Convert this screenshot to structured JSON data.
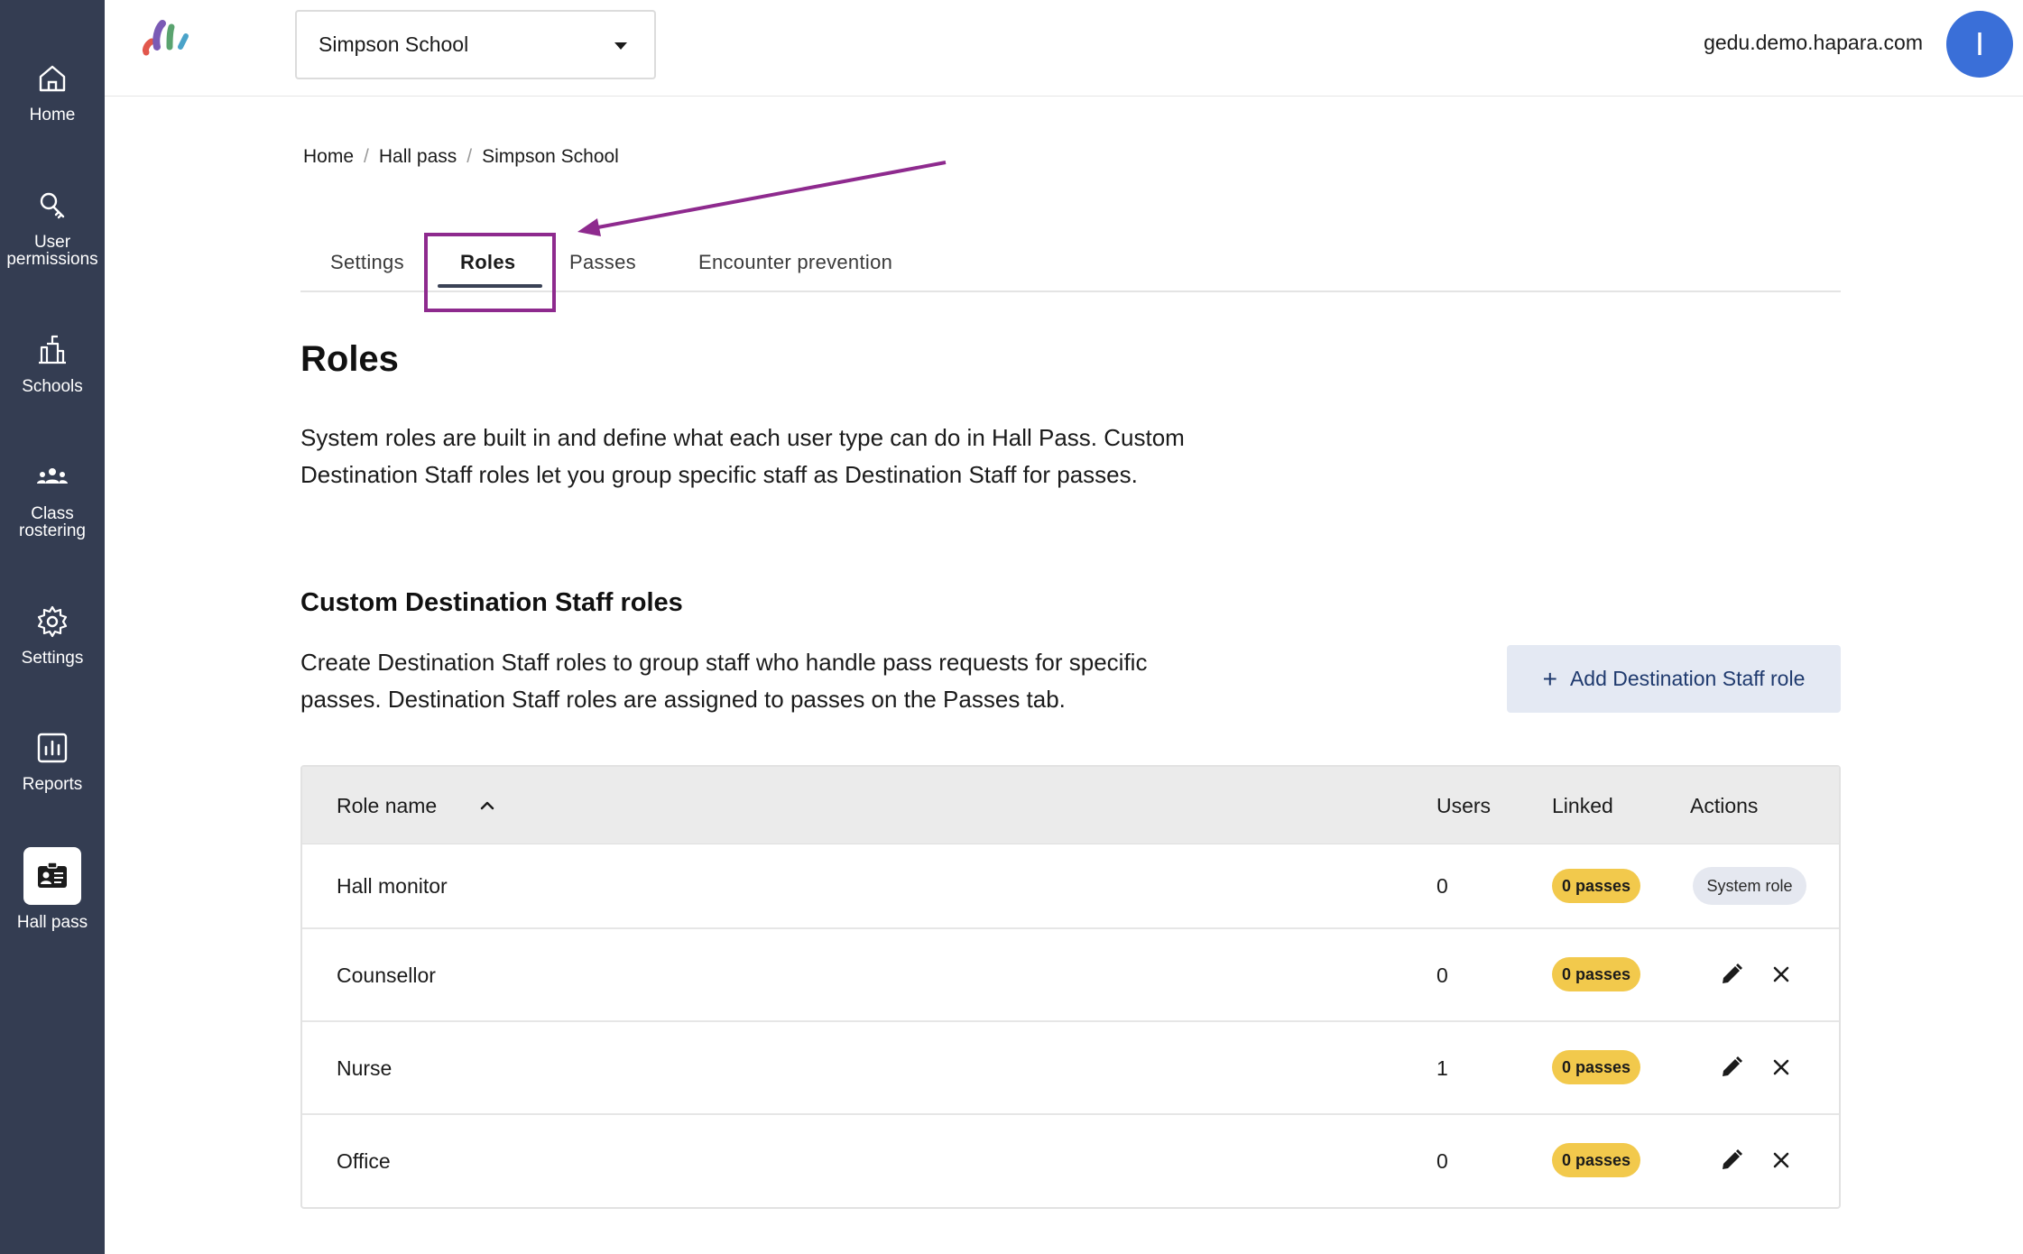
{
  "sidebar": {
    "items": [
      {
        "label": "Home",
        "icon": "home-icon"
      },
      {
        "label": "User permissions",
        "icon": "key-icon"
      },
      {
        "label": "Schools",
        "icon": "school-building-icon"
      },
      {
        "label": "Class rostering",
        "icon": "people-group-icon"
      },
      {
        "label": "Settings",
        "icon": "gear-icon"
      },
      {
        "label": "Reports",
        "icon": "bar-chart-icon"
      },
      {
        "label": "Hall pass",
        "icon": "id-card-icon",
        "active": true
      }
    ]
  },
  "header": {
    "school_select": "Simpson School",
    "domain": "gedu.demo.hapara.com",
    "avatar_initial": "I"
  },
  "breadcrumb": [
    "Home",
    "Hall pass",
    "Simpson School"
  ],
  "tabs": [
    {
      "label": "Settings"
    },
    {
      "label": "Roles",
      "active": true
    },
    {
      "label": "Passes"
    },
    {
      "label": "Encounter prevention"
    }
  ],
  "page": {
    "title": "Roles",
    "description": "System roles are built in and define what each user type can do in Hall Pass. Custom Destination Staff roles let you group specific staff as Destination Staff for passes.",
    "section_title": "Custom Destination Staff roles",
    "section_description": "Create Destination Staff roles to group staff who handle pass requests for specific passes. Destination Staff roles are assigned to passes on the Passes tab.",
    "add_button": "Add Destination Staff role"
  },
  "table": {
    "columns": [
      "Role name",
      "Users",
      "Linked",
      "Actions"
    ],
    "rows": [
      {
        "name": "Hall monitor",
        "users": "0",
        "linked": "0 passes",
        "action": "System role"
      },
      {
        "name": "Counsellor",
        "users": "0",
        "linked": "0 passes",
        "action": "edit-delete"
      },
      {
        "name": "Nurse",
        "users": "1",
        "linked": "0 passes",
        "action": "edit-delete"
      },
      {
        "name": "Office",
        "users": "0",
        "linked": "0 passes",
        "action": "edit-delete"
      }
    ]
  },
  "colors": {
    "sidebar_bg": "#343d52",
    "accent_highlight": "#8e2a8e",
    "badge_yellow": "#f2c94c",
    "avatar_blue": "#3a6fd8",
    "add_button_bg": "#e4e9f3"
  }
}
